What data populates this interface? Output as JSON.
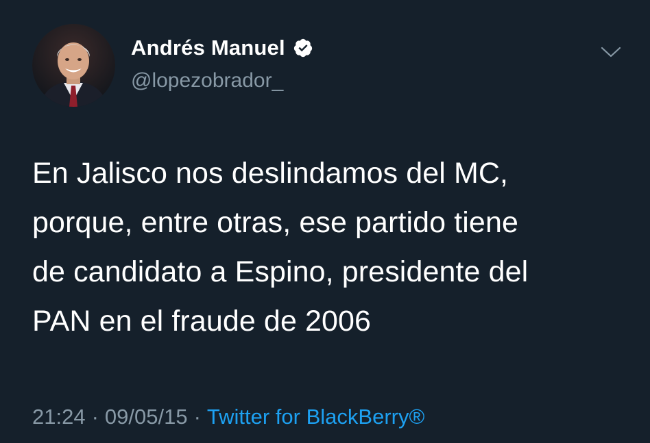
{
  "tweet": {
    "author": {
      "display_name": "Andrés Manuel",
      "handle": "@lopezobrador_",
      "verified": true,
      "avatar_icon": "profile-photo"
    },
    "menu_icon": "chevron-down-icon",
    "text": "En Jalisco nos deslindamos del MC,\nporque, entre otras, ese partido tiene\nde candidato a Espino, presidente del\nPAN en el fraude de 2006",
    "time": "21:24",
    "separator": "·",
    "date": "09/05/15",
    "source": "Twitter for BlackBerry®"
  },
  "colors": {
    "background": "#15202b",
    "text_primary": "#ffffff",
    "text_secondary": "#8899a6",
    "link": "#1da1f2"
  }
}
